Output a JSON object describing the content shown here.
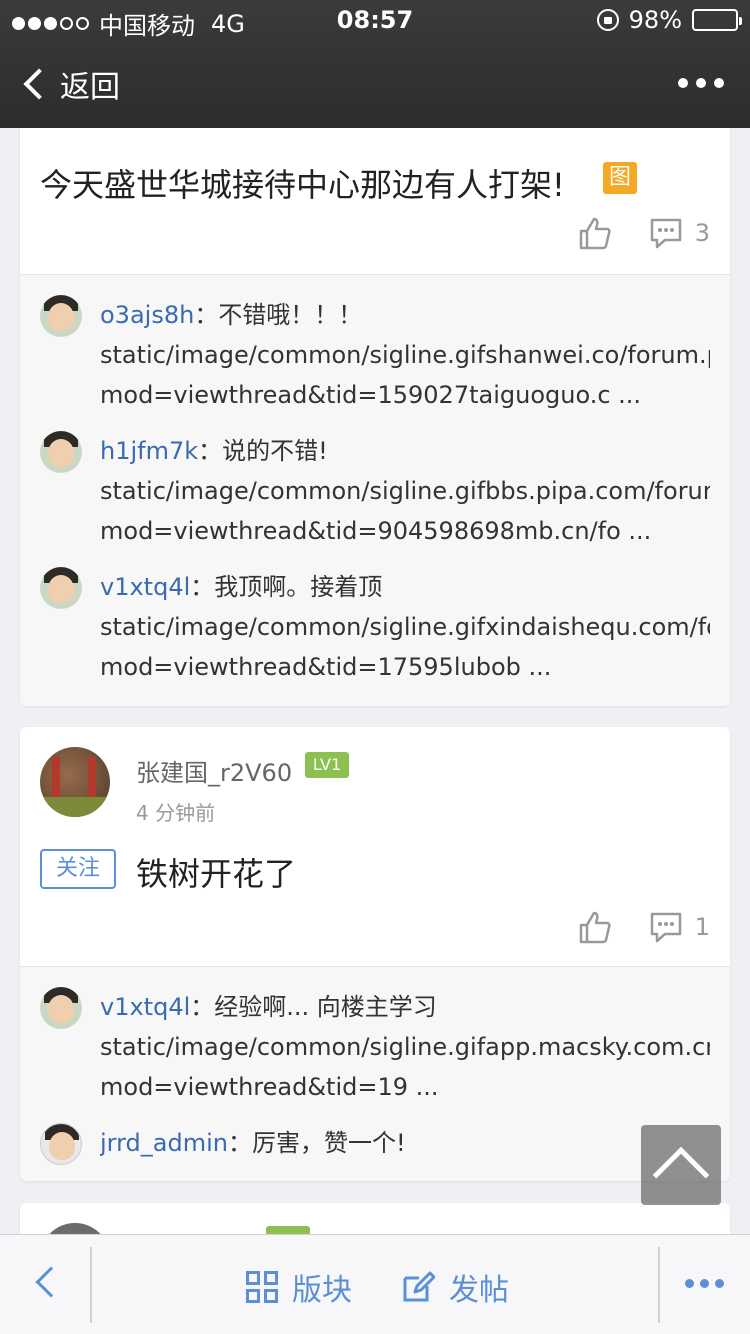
{
  "status_bar": {
    "carrier": "中国移动",
    "network": "4G",
    "time": "08:57",
    "battery": "98%",
    "battery_level": 0.98
  },
  "nav": {
    "back_label": "返回"
  },
  "post1": {
    "text": "今天盛世华城接待中心那边有人打架!",
    "image_badge": "图",
    "comment_count": "3",
    "replies": [
      {
        "user": "o3ajs8h",
        "text": "不错哦！！！",
        "line2": "static/image/common/sigline.gifshanwei.co/forum.ph",
        "line3": "mod=viewthread&tid=159027taiguoguo.c ..."
      },
      {
        "user": "h1jfm7k",
        "text": "说的不错!",
        "line2": "static/image/common/sigline.gifbbs.pipa.com/forum",
        "line3": "mod=viewthread&tid=904598698mb.cn/fo ..."
      },
      {
        "user": "v1xtq4l",
        "text": "我顶啊。接着顶",
        "line2": "static/image/common/sigline.gifxindaishequ.com/for",
        "line3": "mod=viewthread&tid=17595lubob ..."
      }
    ]
  },
  "post2": {
    "username": "张建国_r2V60",
    "level": "LV1",
    "time_ago": "4 分钟前",
    "follow_label": "关注",
    "text": "铁树开花了",
    "comment_count": "1",
    "replies": [
      {
        "user": "v1xtq4l",
        "text": "经验啊... 向楼主学习",
        "line2": "static/image/common/sigline.gifapp.macsky.com.cn/",
        "line3": "mod=viewthread&tid=19 ..."
      },
      {
        "user": "jrrd_admin",
        "text": "厉害，赞一个!"
      }
    ]
  },
  "bottom_bar": {
    "sections_label": "版块",
    "post_label": "发帖"
  },
  "colors": {
    "link_blue": "#3a6ab0",
    "accent_blue": "#5c8fd6",
    "image_badge": "#f5a623",
    "level_badge": "#8cc152"
  }
}
